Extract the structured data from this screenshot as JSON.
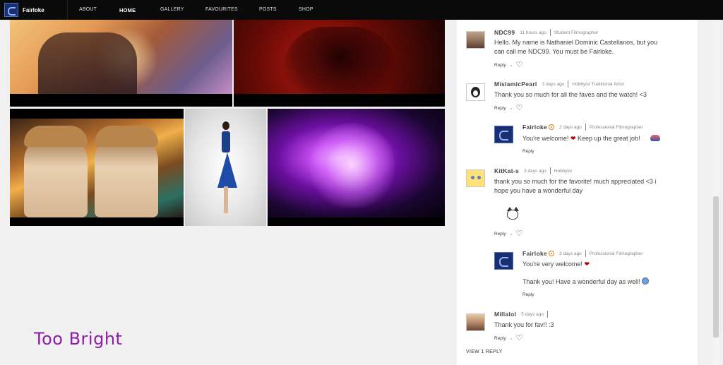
{
  "nav": {
    "brand": "Fairloke",
    "links": [
      "ABOUT",
      "HOME",
      "GALLERY",
      "FAVOURITES",
      "POSTS",
      "SHOP"
    ],
    "active": "HOME"
  },
  "gallery": {
    "caption": "Too Bright",
    "caption_color": "#8e1ca6"
  },
  "comments": [
    {
      "user": "NDC99",
      "time": "11 hours ago",
      "role": "Student Filmographer",
      "text": "Hello. My name is Nathaniel Dominic Castellanos, but you can call me NDC99. You must be Fairloke.",
      "reply": "Reply"
    },
    {
      "user": "MislamicPearl",
      "time": "3 days ago",
      "role": "Hobbyist Traditional Artist",
      "text": "Thank you so much for all the faves and the watch! <3",
      "reply": "Reply"
    },
    {
      "user": "Fairloke",
      "time": "2 days ago",
      "role": "Professional Filmographer",
      "text_a": "You're welcome!",
      "text_b": "Keep up the great job!",
      "reply": "Reply"
    },
    {
      "user": "KitKat-s",
      "time": "3 days ago",
      "role": "Hobbyist",
      "text": "thank you so much for the favorite! much appreciated <3 i hope you have a wonderful day",
      "reply": "Reply"
    },
    {
      "user": "Fairloke",
      "time": "3 days ago",
      "role": "Professional Filmographer",
      "text_a": "You're very welcome!",
      "text_b": "Thank you! Have a wonderful day as well!",
      "reply": "Reply"
    },
    {
      "user": "Millalol",
      "time": "5 days ago",
      "role": "",
      "text": "Thank you for fav!! :3",
      "reply": "Reply"
    }
  ],
  "view_reply": "VIEW 1 REPLY",
  "heart_glyph": "❤"
}
